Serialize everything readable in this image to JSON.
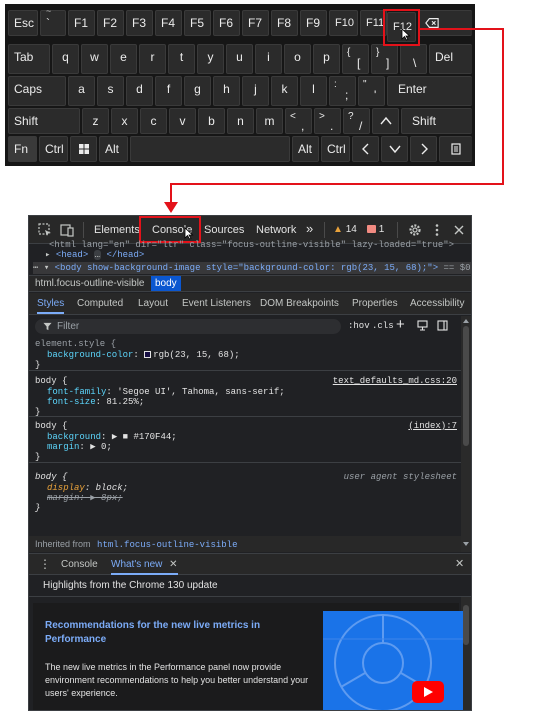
{
  "keyboard": {
    "row1": [
      "Esc",
      "`",
      "F1",
      "F2",
      "F3",
      "F4",
      "F5",
      "F6",
      "F7",
      "F8",
      "F9",
      "F10",
      "F11",
      "F12"
    ],
    "row1_sub": "~",
    "row2": [
      "Tab",
      "q",
      "w",
      "e",
      "r",
      "t",
      "y",
      "u",
      "i",
      "o",
      "p",
      "[",
      "]",
      "Del"
    ],
    "row2_sub": [
      "{",
      "}",
      "\\"
    ],
    "row3": [
      "Caps",
      "a",
      "s",
      "d",
      "f",
      "g",
      "h",
      "j",
      "k",
      "l",
      ";",
      "'",
      "Enter"
    ],
    "row3_sub": [
      ":",
      "\""
    ],
    "row4": [
      "Shift",
      "z",
      "x",
      "c",
      "v",
      "b",
      "n",
      "m",
      ",",
      ".",
      "/",
      "Shift"
    ],
    "row4_sub": [
      "<",
      ">",
      "?"
    ],
    "row5": [
      "Fn",
      "Ctrl",
      "Alt",
      "Alt",
      "Ctrl"
    ],
    "icons": [
      "backspace-icon",
      "windows-icon",
      "arrow-up-icon",
      "arrow-left-icon",
      "arrow-down-icon",
      "arrow-right-icon",
      "menu-icon"
    ],
    "highlight_color": "#e3121a"
  },
  "devtools": {
    "toolbar": {
      "tabs": [
        "Elements",
        "Console",
        "Sources",
        "Network"
      ],
      "more": "»",
      "warnings": "14",
      "errors": "1",
      "warning_color": "#e9a23b",
      "error_color": "#f28b82"
    },
    "elements": {
      "line1": "<html lang=\"en\" dir=\"ltr\" class=\"focus-outline-visible\" lazy-loaded=\"true\">",
      "line2_head": "<head>",
      "line2_ellipsis": "…",
      "line2_close": "</head>",
      "line3_prefix": "⋯ ▾ ",
      "line3_body": "<body show-background-image style=\"background-color: rgb(23, 15, 68);\">",
      "line3_suffix": " == $0"
    },
    "breadcrumb": [
      "html.focus-outline-visible",
      "body"
    ],
    "styles_tabs": [
      "Styles",
      "Computed",
      "Layout",
      "Event Listeners",
      "DOM Breakpoints",
      "Properties",
      "Accessibility"
    ],
    "filter": {
      "placeholder": "Filter",
      "hov": ":hov",
      "cls": ".cls"
    },
    "rules": [
      {
        "selector": "element.style {",
        "props": [
          {
            "name": "background-color",
            "value": "rgb(23, 15, 68);",
            "swatch": "#170f44"
          }
        ],
        "close": "}",
        "source": ""
      },
      {
        "selector": "body {",
        "props": [
          {
            "name": "font-family",
            "value": "'Segoe UI', Tahoma, sans-serif;"
          },
          {
            "name": "font-size",
            "value": "81.25%;"
          }
        ],
        "close": "}",
        "source": "text_defaults_md.css:20"
      },
      {
        "selector": "body {",
        "props": [
          {
            "name": "background",
            "value": "▶ ■ #170F44;",
            "swatch": "#170f44"
          },
          {
            "name": "margin",
            "value": "▶ 0;"
          }
        ],
        "close": "}",
        "source": "(index):7"
      },
      {
        "selector": "body {",
        "props": [
          {
            "name": "display",
            "value": "block;"
          },
          {
            "name": "margin",
            "value": "▶ 8px;"
          }
        ],
        "close": "}",
        "source": "user agent stylesheet"
      }
    ],
    "inherited_label": "Inherited from",
    "inherited_value": "html.focus-outline-visible",
    "drawer": {
      "tabs": [
        "Console",
        "What's new"
      ],
      "highlights": "Highlights from the Chrome 130 update",
      "card_title": "Recommendations for the new live metrics in Performance",
      "card_body": "The new live metrics in the Performance panel now provide environment recommendations to help you better understand your users' experience."
    }
  }
}
